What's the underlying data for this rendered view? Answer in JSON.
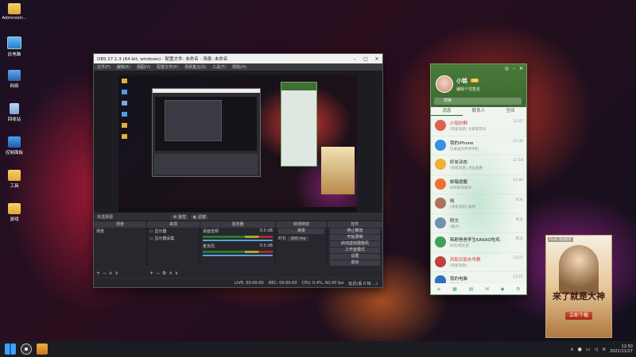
{
  "desktop": {
    "icons": [
      {
        "label": "Administr...",
        "kind": "folder"
      },
      {
        "label": "此电脑",
        "kind": "monitor"
      },
      {
        "label": "网络",
        "kind": "net"
      },
      {
        "label": "回收站",
        "kind": "bin"
      },
      {
        "label": "控制面板",
        "kind": "ctrl"
      },
      {
        "label": "工具",
        "kind": "folder"
      },
      {
        "label": "游戏",
        "kind": "folder"
      }
    ]
  },
  "obs": {
    "title": "OBS 27.1.3 (64-bit, windows) - 配置文件: 未命名 - 场景: 未命名",
    "menu": [
      "文件(F)",
      "编辑(E)",
      "视图(V)",
      "配置文件(P)",
      "场景集合(S)",
      "工具(T)",
      "帮助(H)"
    ],
    "source_bar": {
      "label": "未选择源",
      "properties": "属性",
      "filters": "滤镜"
    },
    "docks": {
      "scenes": {
        "title": "场景",
        "items": [
          "场景"
        ]
      },
      "sources": {
        "title": "来源",
        "items": [
          "显示器",
          "显示器采集"
        ]
      },
      "mixer": {
        "title": "混音器",
        "channels": [
          {
            "name": "桌面音频",
            "db": "0.0 dB"
          },
          {
            "name": "麦克风",
            "db": "0.0 dB"
          }
        ]
      },
      "transitions": {
        "title": "转场特效",
        "type": "渐变",
        "duration_label": "时长",
        "duration": "300 ms"
      },
      "controls": {
        "title": "控件",
        "buttons": [
          "停止推流",
          "开始录制",
          "启动虚拟摄像机",
          "工作室模式",
          "设置",
          "退出"
        ]
      }
    },
    "status": {
      "live": "LIVE: 00:00:00",
      "rec": "REC: 00:00:00",
      "cpu": "CPU: 0.4%, 60.00 fps",
      "delay": "延迟(丢 0 帧 ...)"
    }
  },
  "chat": {
    "nickname": "小铭",
    "vip_badge": "VIP",
    "signature": "编辑个性签名",
    "search_placeholder": "搜索",
    "tabs": [
      "消息",
      "联系人",
      "空间"
    ],
    "contacts": [
      {
        "name": "小铭的群",
        "msg": "[有新消息] 大家新年好",
        "time": "12:47",
        "color": "#e06050",
        "red": true
      },
      {
        "name": "我的iPhone",
        "msg": "已发送文件到手机",
        "time": "12:38",
        "color": "#3a8ee0",
        "red": false
      },
      {
        "name": "好友动态",
        "msg": "[有新消息] 点击查看",
        "time": "12:18",
        "color": "#f0b030",
        "red": false
      },
      {
        "name": "邮箱提醒",
        "msg": "你有新的邮件",
        "time": "11:40",
        "color": "#f07030",
        "red": false
      },
      {
        "name": "晓",
        "msg": "[语音消息] 收到",
        "time": "昨天",
        "color": "#b07060",
        "red": false
      },
      {
        "name": "阿文",
        "msg": "[图片]",
        "time": "昨天",
        "color": "#7090b0",
        "red": false
      },
      {
        "name": "韩剧爸爸李生KAKAO吃鸡",
        "msg": "好的,明天见",
        "time": "昨天",
        "color": "#40a060",
        "red": false
      },
      {
        "name": "风和日丽水华群",
        "msg": "[有新消息]",
        "time": "11/22",
        "color": "#c04040",
        "red": true
      },
      {
        "name": "我的电脑",
        "msg": "已接收文件",
        "time": "11/21",
        "color": "#3070c0",
        "red": false
      }
    ]
  },
  "ad": {
    "tag": "Flash 游戏推荐",
    "slogan": "来了就是大神",
    "download": "立即下载"
  },
  "taskbar": {
    "time": "12:50",
    "date": "2021/11/27"
  }
}
